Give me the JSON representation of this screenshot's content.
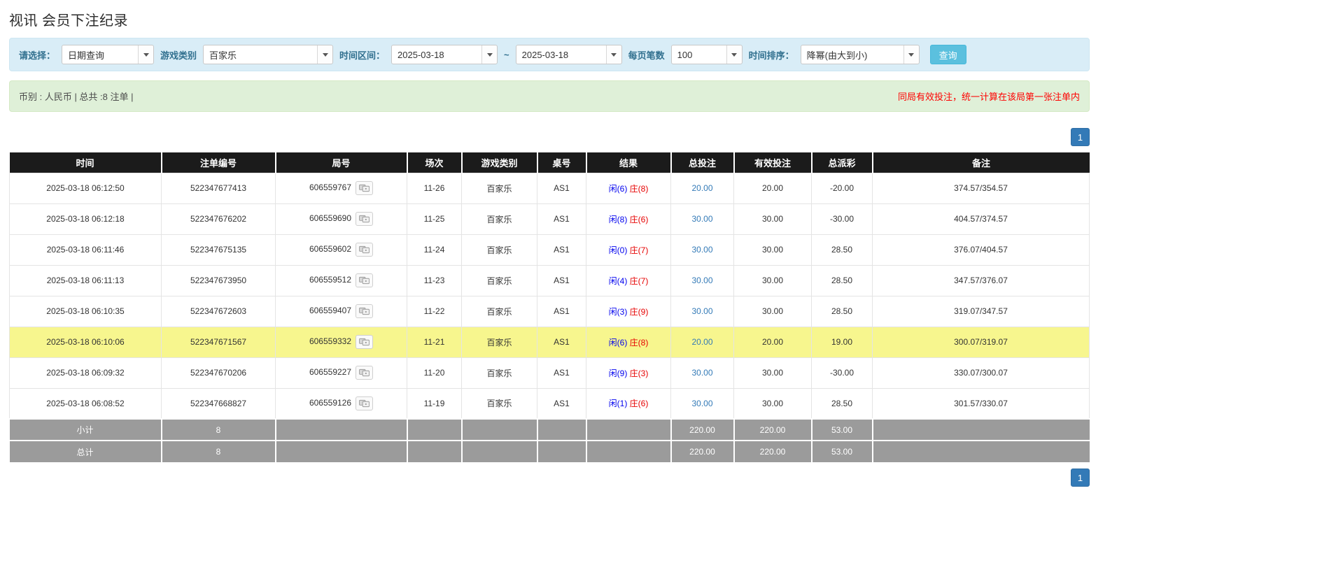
{
  "page": {
    "title": "视讯 会员下注纪录"
  },
  "filters": {
    "select_label": "请选择：",
    "select_value": "日期查询",
    "game_label": "游戏类别",
    "game_value": "百家乐",
    "range_label": "时间区间：",
    "date_from": "2025-03-18",
    "range_separator": "~",
    "date_to": "2025-03-18",
    "page_size_label": "每页笔数",
    "page_size_value": "100",
    "sort_label": "时间排序：",
    "sort_value": "降幂(由大到小)",
    "search_button": "查询"
  },
  "info_bar": {
    "summary": "币别 : 人民币 | 总共 :8 注单 |",
    "notice": "同局有效投注，统一计算在该局第一张注单内"
  },
  "pagination": {
    "current_page": "1"
  },
  "table": {
    "headers": [
      "时间",
      "注单编号",
      "局号",
      "场次",
      "游戏类别",
      "桌号",
      "结果",
      "总投注",
      "有效投注",
      "总派彩",
      "备注"
    ],
    "rows": [
      {
        "time": "2025-03-18 06:12:50",
        "bet_id": "522347677413",
        "round_id": "606559767",
        "session": "11-26",
        "game": "百家乐",
        "table_no": "AS1",
        "player": "闲(6)",
        "banker": "庄(8)",
        "total_bet": "20.00",
        "valid_bet": "20.00",
        "payout": "-20.00",
        "payout_negative": true,
        "remark": "374.57/354.57",
        "highlight": false
      },
      {
        "time": "2025-03-18 06:12:18",
        "bet_id": "522347676202",
        "round_id": "606559690",
        "session": "11-25",
        "game": "百家乐",
        "table_no": "AS1",
        "player": "闲(8)",
        "banker": "庄(6)",
        "total_bet": "30.00",
        "valid_bet": "30.00",
        "payout": "-30.00",
        "payout_negative": true,
        "remark": "404.57/374.57",
        "highlight": false
      },
      {
        "time": "2025-03-18 06:11:46",
        "bet_id": "522347675135",
        "round_id": "606559602",
        "session": "11-24",
        "game": "百家乐",
        "table_no": "AS1",
        "player": "闲(0)",
        "banker": "庄(7)",
        "total_bet": "30.00",
        "valid_bet": "30.00",
        "payout": "28.50",
        "payout_negative": false,
        "remark": "376.07/404.57",
        "highlight": false
      },
      {
        "time": "2025-03-18 06:11:13",
        "bet_id": "522347673950",
        "round_id": "606559512",
        "session": "11-23",
        "game": "百家乐",
        "table_no": "AS1",
        "player": "闲(4)",
        "banker": "庄(7)",
        "total_bet": "30.00",
        "valid_bet": "30.00",
        "payout": "28.50",
        "payout_negative": false,
        "remark": "347.57/376.07",
        "highlight": false
      },
      {
        "time": "2025-03-18 06:10:35",
        "bet_id": "522347672603",
        "round_id": "606559407",
        "session": "11-22",
        "game": "百家乐",
        "table_no": "AS1",
        "player": "闲(3)",
        "banker": "庄(9)",
        "total_bet": "30.00",
        "valid_bet": "30.00",
        "payout": "28.50",
        "payout_negative": false,
        "remark": "319.07/347.57",
        "highlight": false
      },
      {
        "time": "2025-03-18 06:10:06",
        "bet_id": "522347671567",
        "round_id": "606559332",
        "session": "11-21",
        "game": "百家乐",
        "table_no": "AS1",
        "player": "闲(6)",
        "banker": "庄(8)",
        "total_bet": "20.00",
        "valid_bet": "20.00",
        "payout": "19.00",
        "payout_negative": false,
        "remark": "300.07/319.07",
        "highlight": true
      },
      {
        "time": "2025-03-18 06:09:32",
        "bet_id": "522347670206",
        "round_id": "606559227",
        "session": "11-20",
        "game": "百家乐",
        "table_no": "AS1",
        "player": "闲(9)",
        "banker": "庄(3)",
        "total_bet": "30.00",
        "valid_bet": "30.00",
        "payout": "-30.00",
        "payout_negative": true,
        "remark": "330.07/300.07",
        "highlight": false
      },
      {
        "time": "2025-03-18 06:08:52",
        "bet_id": "522347668827",
        "round_id": "606559126",
        "session": "11-19",
        "game": "百家乐",
        "table_no": "AS1",
        "player": "闲(1)",
        "banker": "庄(6)",
        "total_bet": "30.00",
        "valid_bet": "30.00",
        "payout": "28.50",
        "payout_negative": false,
        "remark": "301.57/330.07",
        "highlight": false
      }
    ],
    "footer_rows": [
      {
        "label": "小计",
        "count": "8",
        "total_bet": "220.00",
        "valid_bet": "220.00",
        "payout": "53.00"
      },
      {
        "label": "总计",
        "count": "8",
        "total_bet": "220.00",
        "valid_bet": "220.00",
        "payout": "53.00"
      }
    ]
  },
  "colors": {
    "player_blue": "#0000ee",
    "banker_red": "#e60000",
    "link_blue": "#337ab7",
    "negative_red": "#fe0000",
    "highlight_yellow": "#f7f68e",
    "header_black": "#1b1b1b",
    "summary_gray": "#9b9b9b",
    "filter_bg": "#d9edf7",
    "info_bg": "#dff0d8",
    "accent_blue": "#337ab7",
    "search_btn_blue": "#5bc0de"
  }
}
